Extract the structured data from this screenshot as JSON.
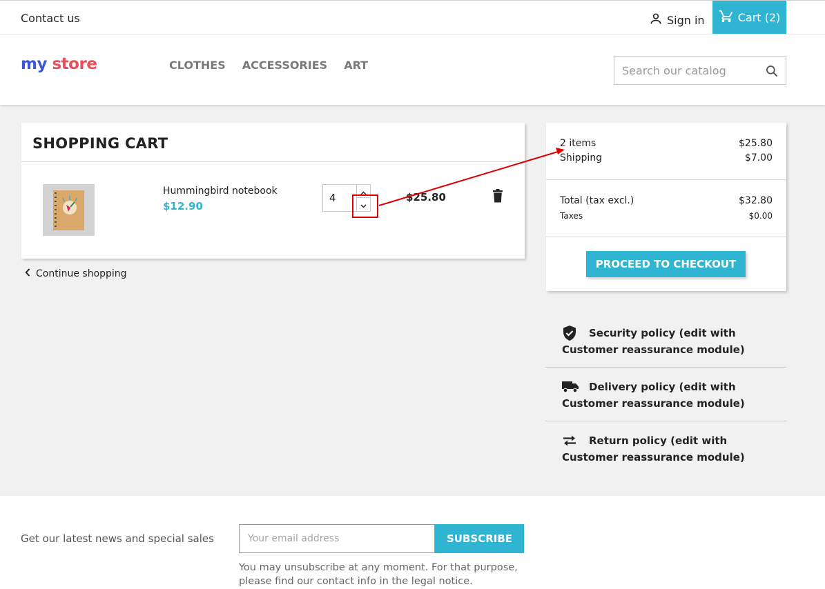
{
  "topbar": {
    "contact": "Contact us",
    "signin": "Sign in",
    "cart": "Cart (2)"
  },
  "header": {
    "logo": {
      "my": "my",
      "store": "store"
    },
    "nav": [
      "CLOTHES",
      "ACCESSORIES",
      "ART"
    ],
    "search_placeholder": "Search our catalog"
  },
  "cart": {
    "title": "SHOPPING CART",
    "item": {
      "name": "Hummingbird notebook",
      "price": "$12.90",
      "quantity": "4",
      "line_total": "$25.80"
    },
    "continue": "Continue shopping"
  },
  "summary": {
    "items_label": "2 items",
    "items_value": "$25.80",
    "shipping_label": "Shipping",
    "shipping_value": "$7.00",
    "total_label": "Total (tax excl.)",
    "total_value": "$32.80",
    "taxes_label": "Taxes",
    "taxes_value": "$0.00",
    "checkout": "PROCEED TO CHECKOUT"
  },
  "reassurance": [
    {
      "icon": "shield-check-icon",
      "text": "Security policy (edit with Customer reassurance module)"
    },
    {
      "icon": "truck-icon",
      "text": "Delivery policy (edit with Customer reassurance module)"
    },
    {
      "icon": "swap-arrows-icon",
      "text": "Return policy (edit with Customer reassurance module)"
    }
  ],
  "footer": {
    "newsletter_label": "Get our latest news and special sales",
    "email_placeholder": "Your email address",
    "subscribe": "SUBSCRIBE",
    "unsubscribe_note": "You may unsubscribe at any moment. For that purpose, please find our contact info in the legal notice."
  },
  "colors": {
    "accent": "#2fb5d2",
    "annotation": "#e00000"
  }
}
